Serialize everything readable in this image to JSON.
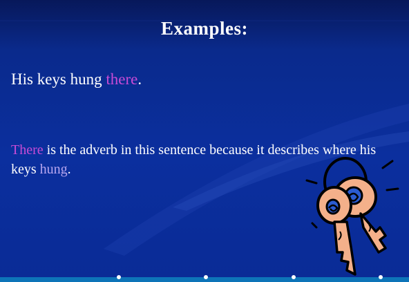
{
  "slide": {
    "title": "Examples:",
    "sentence": {
      "before": "His keys hung ",
      "highlight": "there",
      "after": "."
    },
    "explanation": {
      "highlight1": "There",
      "middle": " is the adverb in this sentence because it describes where his keys ",
      "highlight2": "hung",
      "end": "."
    }
  },
  "colors": {
    "background": "#0b2f9e",
    "highlight_magenta": "#c84bd6",
    "highlight_lavender": "#b8a7f0",
    "bottom_bar": "#0d74b8"
  },
  "decoration": {
    "clipart": "keys-illustration-icon"
  }
}
